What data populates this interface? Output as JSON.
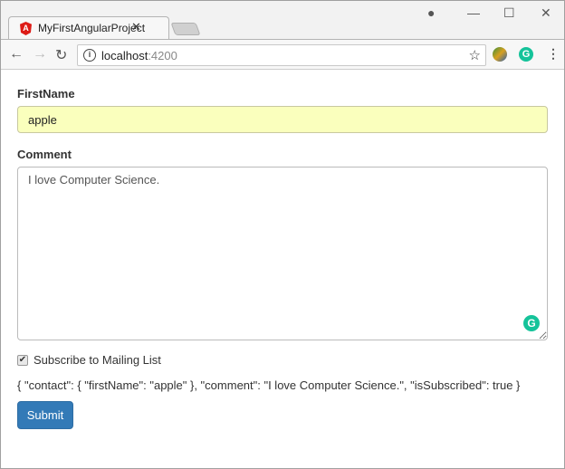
{
  "browser": {
    "tab_title": "MyFirstAngularProject",
    "tab_close": "✕",
    "url_host": "localhost",
    "url_port": ":4200",
    "icons": [
      "angular-logo-icon",
      "account-icon",
      "minimize-icon",
      "maximize-icon",
      "close-icon",
      "back-icon",
      "forward-icon",
      "reload-icon",
      "info-icon",
      "star-icon",
      "extension-icon",
      "grammarly-icon",
      "menu-icon"
    ]
  },
  "form": {
    "first_name_label": "FirstName",
    "first_name_value": "apple",
    "comment_label": "Comment",
    "comment_value": "I love Computer Science.",
    "subscribe_label": "Subscribe to Mailing List",
    "subscribe_checked": true,
    "json_output": "{ \"contact\": { \"firstName\": \"apple\" }, \"comment\": \"I love Computer Science.\", \"isSubscribed\": true }",
    "submit_label": "Submit"
  },
  "colors": {
    "primary": "#337ab7",
    "autofill": "#faffbd",
    "grammarly": "#15c39a"
  }
}
